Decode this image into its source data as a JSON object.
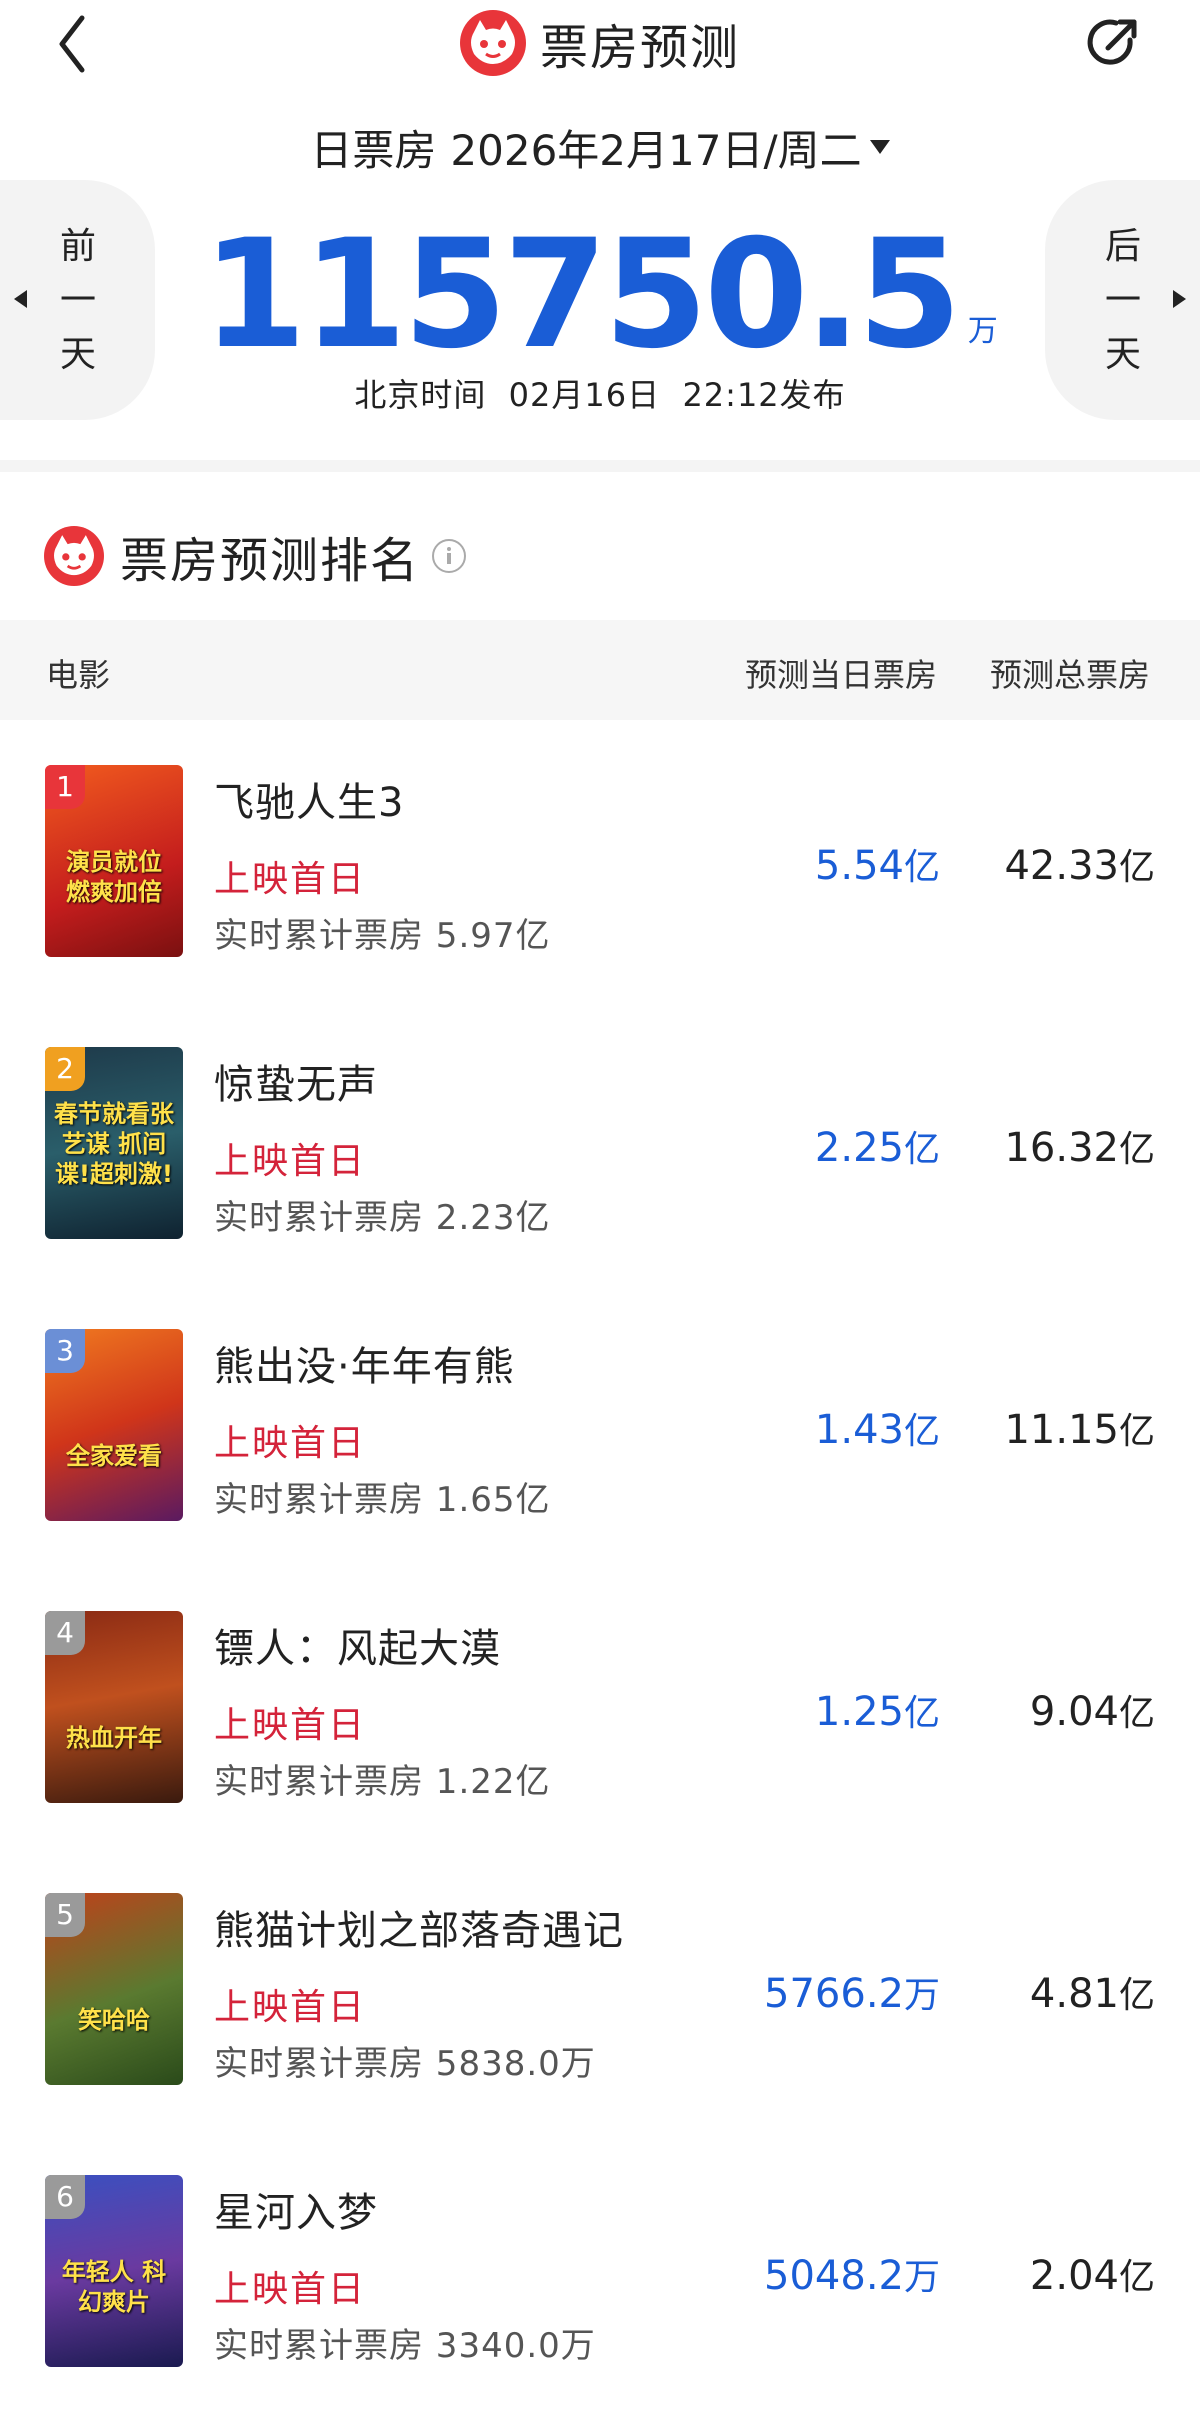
{
  "header": {
    "title": "票房预测",
    "date_label": "日票房",
    "date": "2026年2月17日/周二",
    "prev_day": [
      "前",
      "一",
      "天"
    ],
    "next_day": [
      "后",
      "一",
      "天"
    ],
    "total_value": "115750.5",
    "total_unit": "万",
    "publish_time": "北京时间  02月16日  22:12发布"
  },
  "section": {
    "title": "票房预测排名"
  },
  "table": {
    "col_movie": "电影",
    "col_daily": "预测当日票房",
    "col_total": "预测总票房",
    "rows": [
      {
        "rank": "1",
        "name": "飞驰人生3",
        "status": "上映首日",
        "cumulative": "实时累计票房 5.97亿",
        "daily_num": "5.54",
        "daily_unit": "亿",
        "total_num": "42.33",
        "total_unit": "亿",
        "poster_text": "演员就位 燃爽加倍"
      },
      {
        "rank": "2",
        "name": "惊蛰无声",
        "status": "上映首日",
        "cumulative": "实时累计票房 2.23亿",
        "daily_num": "2.25",
        "daily_unit": "亿",
        "total_num": "16.32",
        "total_unit": "亿",
        "poster_text": "春节就看张艺谋 抓间谍!超刺激!"
      },
      {
        "rank": "3",
        "name": "熊出没·年年有熊",
        "status": "上映首日",
        "cumulative": "实时累计票房 1.65亿",
        "daily_num": "1.43",
        "daily_unit": "亿",
        "total_num": "11.15",
        "total_unit": "亿",
        "poster_text": "全家爱看"
      },
      {
        "rank": "4",
        "name": "镖人：风起大漠",
        "status": "上映首日",
        "cumulative": "实时累计票房 1.22亿",
        "daily_num": "1.25",
        "daily_unit": "亿",
        "total_num": "9.04",
        "total_unit": "亿",
        "poster_text": "热血开年"
      },
      {
        "rank": "5",
        "name": "熊猫计划之部落奇遇记",
        "status": "上映首日",
        "cumulative": "实时累计票房 5838.0万",
        "daily_num": "5766.2",
        "daily_unit": "万",
        "total_num": "4.81",
        "total_unit": "亿",
        "poster_text": "笑哈哈"
      },
      {
        "rank": "6",
        "name": "星河入梦",
        "status": "上映首日",
        "cumulative": "实时累计票房 3340.0万",
        "daily_num": "5048.2",
        "daily_unit": "万",
        "total_num": "2.04",
        "total_unit": "亿",
        "poster_text": "年轻人 科幻爽片"
      }
    ]
  },
  "colors": {
    "brand_red": "#e8353a",
    "accent_blue": "#1a5dd6",
    "status_red": "#d4233a",
    "rank_colors": [
      "#e8353a",
      "#f0a020",
      "#6b8fd6",
      "#9a9a9a",
      "#9a9a9a",
      "#9a9a9a"
    ]
  },
  "icons": {
    "back": "chevron-left-icon",
    "share": "share-icon",
    "logo": "cat-logo-icon",
    "info": "info-icon"
  }
}
